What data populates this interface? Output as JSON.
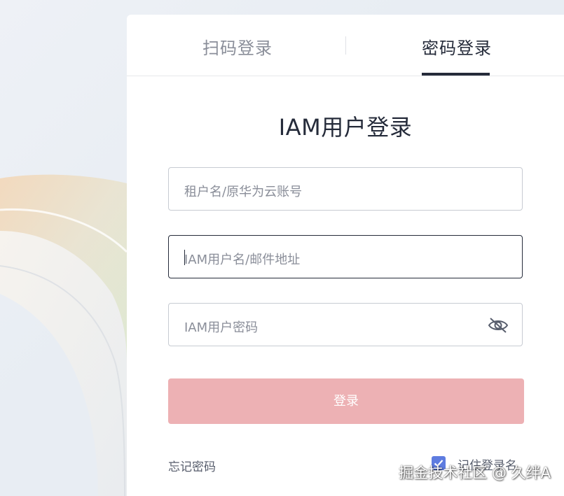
{
  "tabs": [
    {
      "label": "扫码登录",
      "active": false
    },
    {
      "label": "密码登录",
      "active": true
    }
  ],
  "title": "IAM用户登录",
  "fields": {
    "tenant": {
      "placeholder": "租户名/原华为云账号",
      "value": ""
    },
    "username": {
      "placeholder": "IAM用户名/邮件地址",
      "value": "",
      "focused": true
    },
    "password": {
      "placeholder": "IAM用户密码",
      "value": "",
      "icon": "eye-off-icon"
    }
  },
  "login_button": {
    "label": "登录",
    "enabled": false
  },
  "forgot_password": "忘记密码",
  "remember_username": {
    "label": "记住登录名",
    "checked": true
  },
  "watermark": "掘金技术社区 @ 久绊A",
  "colors": {
    "text_primary": "#252b3a",
    "text_secondary": "#8a8e99",
    "button_disabled": "#edb1b4",
    "checkbox": "#5e7ce0"
  }
}
